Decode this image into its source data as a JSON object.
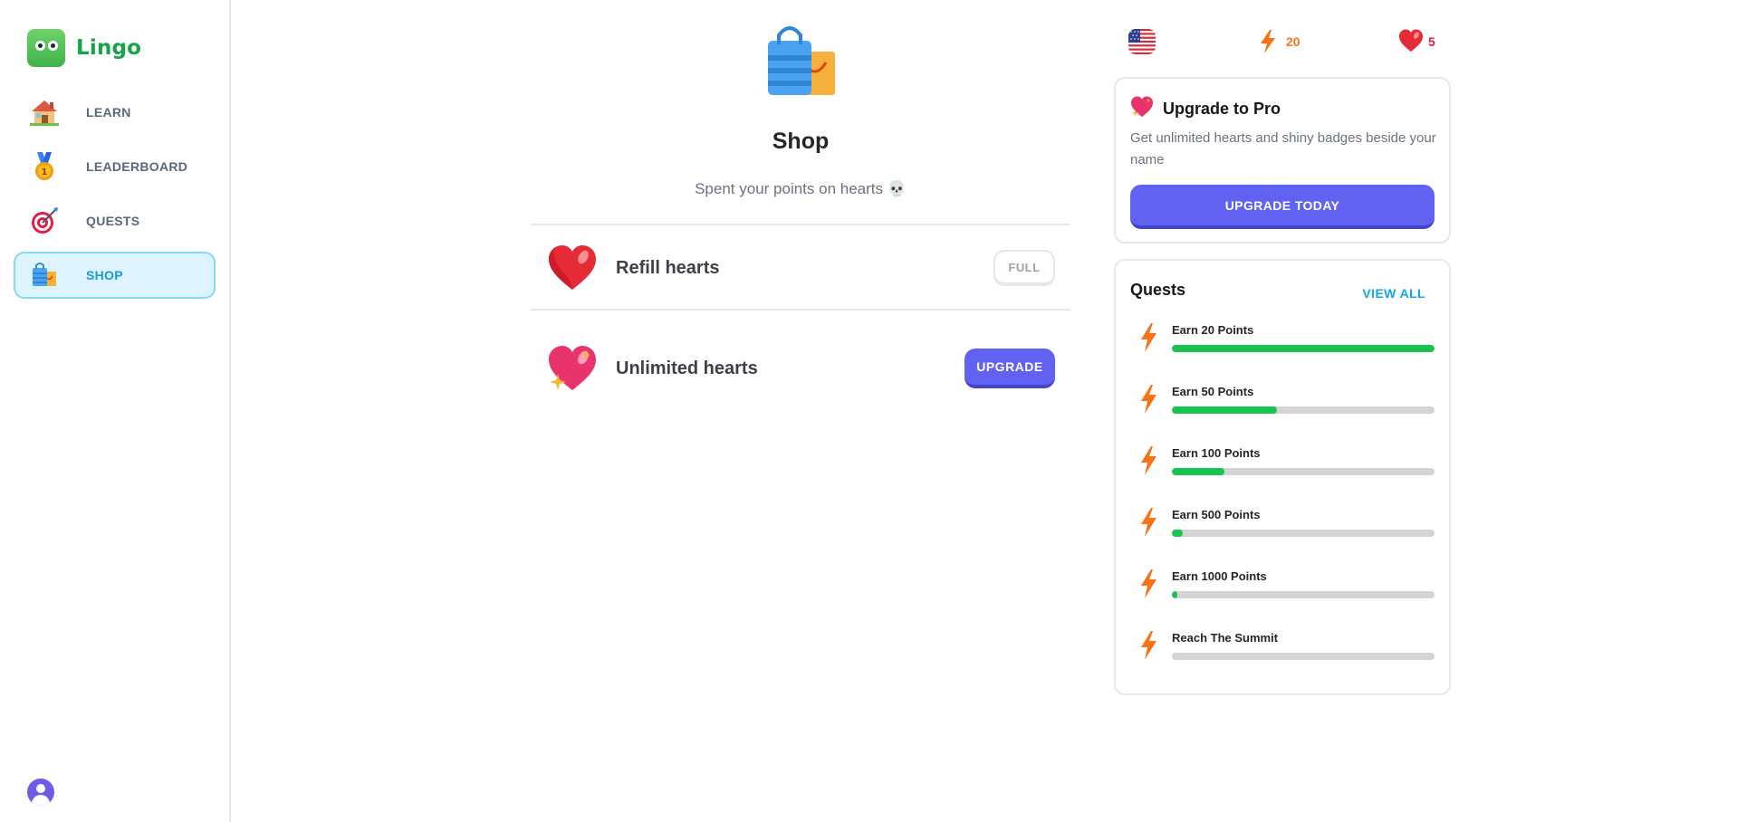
{
  "app": {
    "name": "Lingo"
  },
  "sidebar": {
    "items": [
      {
        "label": "LEARN",
        "icon": "home-icon",
        "active": false
      },
      {
        "label": "LEADERBOARD",
        "icon": "medal-icon",
        "active": false
      },
      {
        "label": "QUESTS",
        "icon": "target-icon",
        "active": false
      },
      {
        "label": "SHOP",
        "icon": "shopping-bag-icon",
        "active": true
      }
    ],
    "profile_icon": "user-avatar-icon"
  },
  "shop": {
    "title": "Shop",
    "subtitle": "Spent your points on hearts 💀",
    "items": [
      {
        "title": "Refill hearts",
        "icon": "heart-icon",
        "button": "FULL",
        "disabled": true
      },
      {
        "title": "Unlimited hearts",
        "icon": "sparkling-heart-icon",
        "button": "UPGRADE",
        "disabled": false
      }
    ]
  },
  "stats": {
    "language_flag": "us-flag-icon",
    "points": "20",
    "hearts": "5"
  },
  "pro": {
    "title": "Upgrade to Pro",
    "description": "Get unlimited hearts and shiny badges beside your name",
    "button": "UPGRADE TODAY"
  },
  "quests": {
    "title": "Quests",
    "view_all": "VIEW ALL",
    "items": [
      {
        "label": "Earn 20 Points",
        "progress": 1.0
      },
      {
        "label": "Earn 50 Points",
        "progress": 0.4
      },
      {
        "label": "Earn 100 Points",
        "progress": 0.2
      },
      {
        "label": "Earn 500 Points",
        "progress": 0.04
      },
      {
        "label": "Earn 1000 Points",
        "progress": 0.02
      },
      {
        "label": "Reach The Summit",
        "progress": 0.0
      }
    ]
  },
  "colors": {
    "brand": "#16a34a",
    "accent": "#6161f2",
    "active_nav": "#1899d6",
    "progress": "#16c44f",
    "points": "#f97316",
    "hearts": "#e11d48"
  }
}
